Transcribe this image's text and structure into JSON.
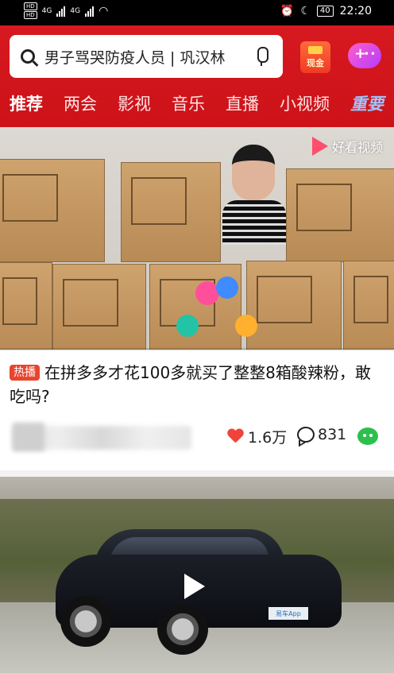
{
  "status_bar": {
    "hd_label": "HD",
    "net_label": "4G",
    "battery": "40",
    "time": "22:20"
  },
  "header": {
    "search_placeholder": "男子骂哭防疫人员 | 巩汉林",
    "cash_label": "现金",
    "accent_color": "#d71920",
    "tabs": [
      "推荐",
      "两会",
      "影视",
      "音乐",
      "直播",
      "小视频",
      "重要"
    ]
  },
  "feed": {
    "video1": {
      "watermark": "好看视频",
      "badge": "热播",
      "title": "在拼多多才花100多就买了整整8箱酸辣粉，敢吃吗?",
      "likes": "1.6万",
      "comments": "831",
      "progress": 0.0
    },
    "video2": {
      "plate_text": "易车App"
    }
  }
}
